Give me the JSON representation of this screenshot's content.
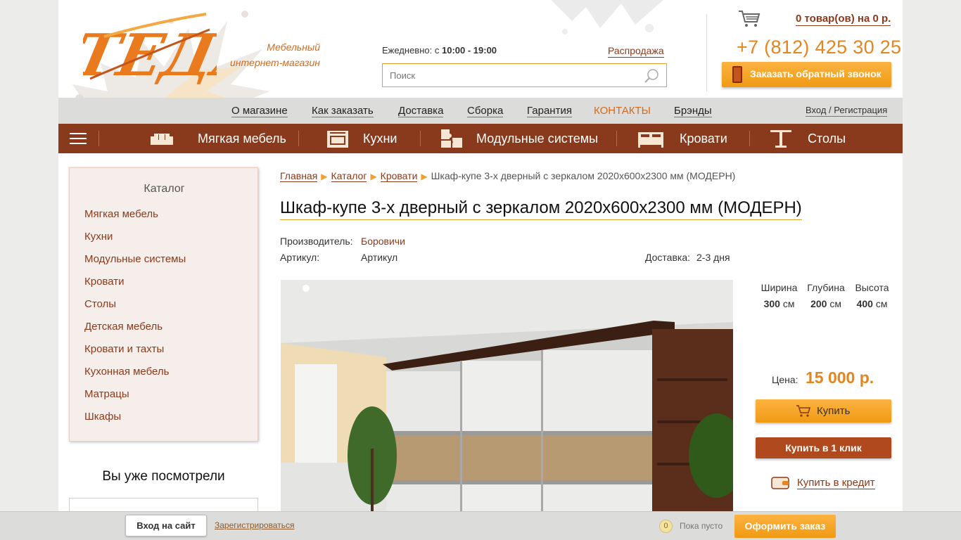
{
  "header": {
    "logo_text": "ТЕДА",
    "tagline_line1": "Мебельный",
    "tagline_line2": "интернет-магазин",
    "hours_prefix": "Ежедневно: с",
    "hours_value": "10:00 - 19:00",
    "sale_link": "Распродажа",
    "search_placeholder": "Поиск",
    "cart_count_text": "0 товар(ов) на",
    "cart_sum": "0 р.",
    "phone": "+7 (812) 425 30 25",
    "callback_button": "Заказать обратный звонок",
    "accent_color": "#e38520",
    "brand_color": "#8a3a1c"
  },
  "topnav": {
    "items": [
      "О магазине",
      "Как заказать",
      "Доставка",
      "Сборка",
      "Гарантия",
      "КОНТАКТЫ",
      "Брэнды"
    ],
    "login": "Вход / Регистрация"
  },
  "catnav": {
    "items": [
      {
        "label": "Мягкая мебель",
        "icon": "sofa-icon"
      },
      {
        "label": "Кухни",
        "icon": "oven-icon"
      },
      {
        "label": "Модульные системы",
        "icon": "puzzle-icon"
      },
      {
        "label": "Кровати",
        "icon": "bed-icon"
      },
      {
        "label": "Столы",
        "icon": "table-icon"
      }
    ]
  },
  "sidebar": {
    "title": "Каталог",
    "items": [
      "Мягкая мебель",
      "Кухни",
      "Модульные системы",
      "Кровати",
      "Столы",
      "Детская мебель",
      "Кровати и тахты",
      "Кухонная мебель",
      "Матрацы",
      "Шкафы"
    ],
    "seen_title": "Вы уже посмотрели"
  },
  "breadcrumb": {
    "items": [
      "Главная",
      "Каталог",
      "Кровати"
    ],
    "current": "Шкаф-купе 3-х дверный с зеркалом 2020x600x2300 мм (МОДЕРН)"
  },
  "product": {
    "title": "Шкаф-купе 3-х дверный с зеркалом 2020x600x2300 мм (МОДЕРН)",
    "maker_label": "Производитель:",
    "maker_value": "Боровичи",
    "sku_label": "Артикул:",
    "sku_value": "Артикул",
    "delivery_label": "Доставка:",
    "delivery_value": "2-3 дня",
    "dims": [
      {
        "label": "Ширина",
        "value": "300",
        "unit": "см"
      },
      {
        "label": "Глубина",
        "value": "200",
        "unit": "см"
      },
      {
        "label": "Высота",
        "value": "400",
        "unit": "см"
      }
    ],
    "price_label": "Цена:",
    "price": "15 000 р.",
    "buy_button": "Купить",
    "one_click_button": "Купить в 1 клик",
    "credit_link": "Купить в кредит"
  },
  "bottombar": {
    "login_button": "Вход на сайт",
    "register_link": "Зарегистрироваться",
    "cart_count": "0",
    "cart_empty": "Пока пусто",
    "order_button": "Оформить заказ"
  }
}
